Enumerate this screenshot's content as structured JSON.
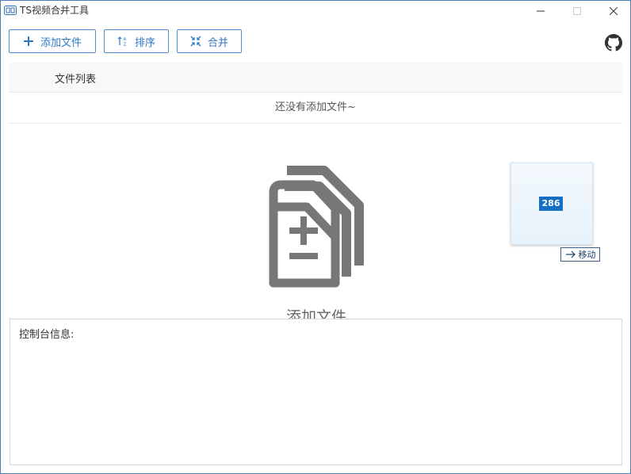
{
  "window": {
    "title": "TS视频合并工具",
    "min_glyph": "—",
    "max_glyph": "☐",
    "close_glyph": "✕"
  },
  "toolbar": {
    "add_label": "添加文件",
    "sort_label": "排序",
    "merge_label": "合并",
    "add_icon": "plus-icon",
    "sort_icon": "sort-az-icon",
    "merge_icon": "merge-arrows-icon",
    "github_icon": "github-icon"
  },
  "file_list": {
    "header": "文件列表",
    "empty_text": "还没有添加文件~"
  },
  "drop_zone": {
    "label": "添加文件",
    "icon": "file-plus-minus-icon"
  },
  "float_widget": {
    "badge": "286",
    "move_label": "移动",
    "move_icon": "arrow-right-icon"
  },
  "console": {
    "label": "控制台信息:"
  },
  "colors": {
    "accent": "#2d78c8",
    "icon_gray": "#777777",
    "badge_blue": "#1570c4"
  }
}
